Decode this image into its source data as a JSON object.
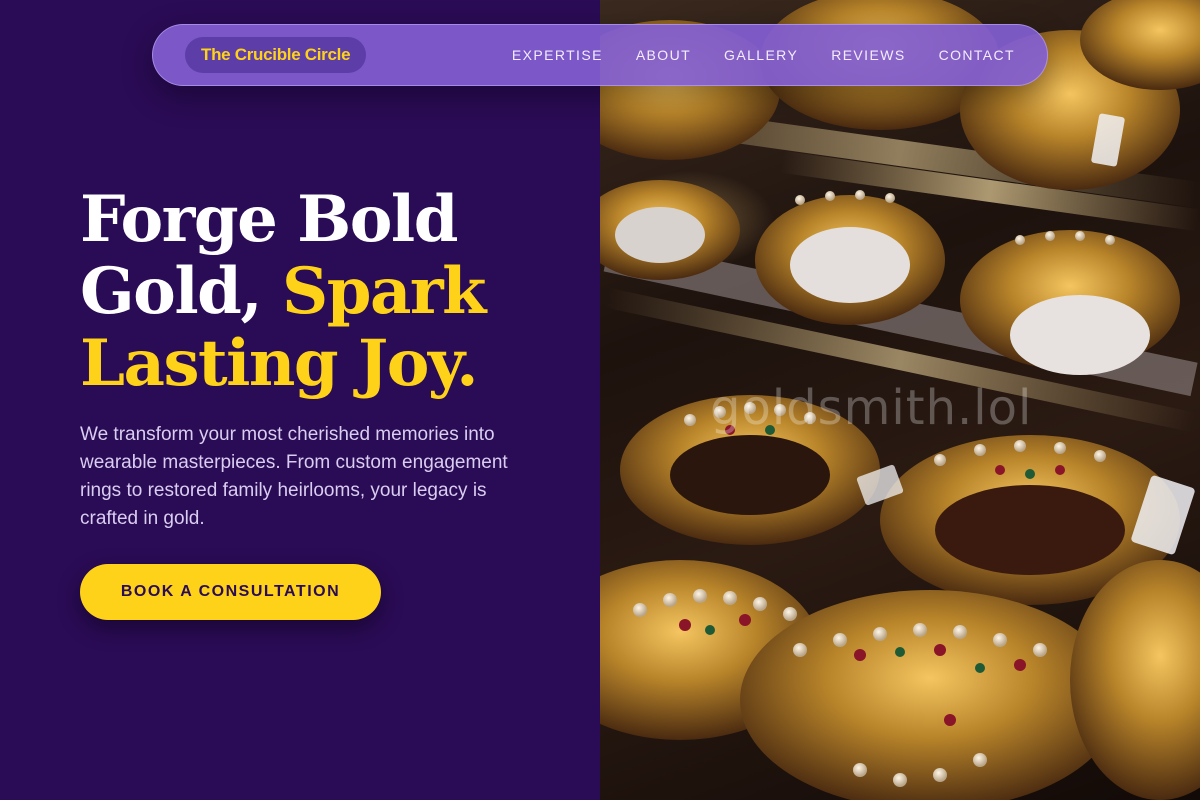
{
  "brand": {
    "name": "The Crucible Circle"
  },
  "nav": {
    "links": [
      "EXPERTISE",
      "ABOUT",
      "GALLERY",
      "REVIEWS",
      "CONTACT"
    ]
  },
  "hero": {
    "headline_white": "Forge Bold Gold,",
    "headline_accent": "Spark Lasting Joy.",
    "subtext": "We transform your most cherished memories into wearable masterpieces. From custom engagement rings to restored family heirlooms, your legacy is crafted in gold.",
    "cta_label": "BOOK A CONSULTATION"
  },
  "image": {
    "subject": "gold-bangles-photo",
    "watermark": "goldsmith.lol"
  },
  "colors": {
    "background": "#2a0b55",
    "accent": "#ffd21a",
    "nav": "#825ed2",
    "text_light": "#d9cdf0"
  }
}
